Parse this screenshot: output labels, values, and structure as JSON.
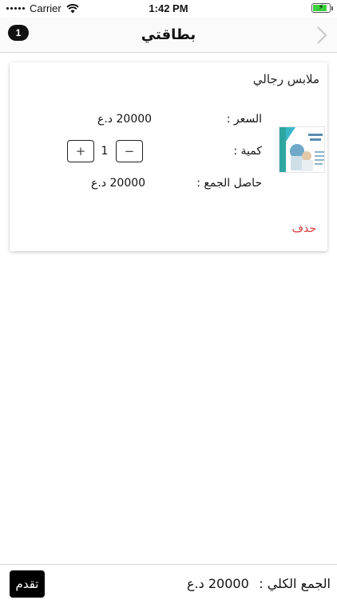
{
  "status_bar": {
    "carrier": "Carrier",
    "time": "1:42 PM",
    "battery_level": 0.85
  },
  "nav": {
    "title": "بطاقتي",
    "cart_count": "1"
  },
  "cart_item": {
    "name": "ملابس رجالي",
    "price_label": "السعر :",
    "price_value": "20000 د.ع",
    "quantity_label": "كمية :",
    "quantity_value": "1",
    "increment_label": "+",
    "decrement_label": "−",
    "subtotal_label": "حاصل الجمع :",
    "subtotal_value": "20000 د.ع",
    "delete_label": "حذف"
  },
  "footer": {
    "total_label": "الجمع الكلي :",
    "total_value": "20000 د.ع",
    "proceed_label": "تقدم"
  },
  "colors": {
    "accent": "#000000",
    "delete": "#d63a3a",
    "battery": "#3ccf3c"
  }
}
